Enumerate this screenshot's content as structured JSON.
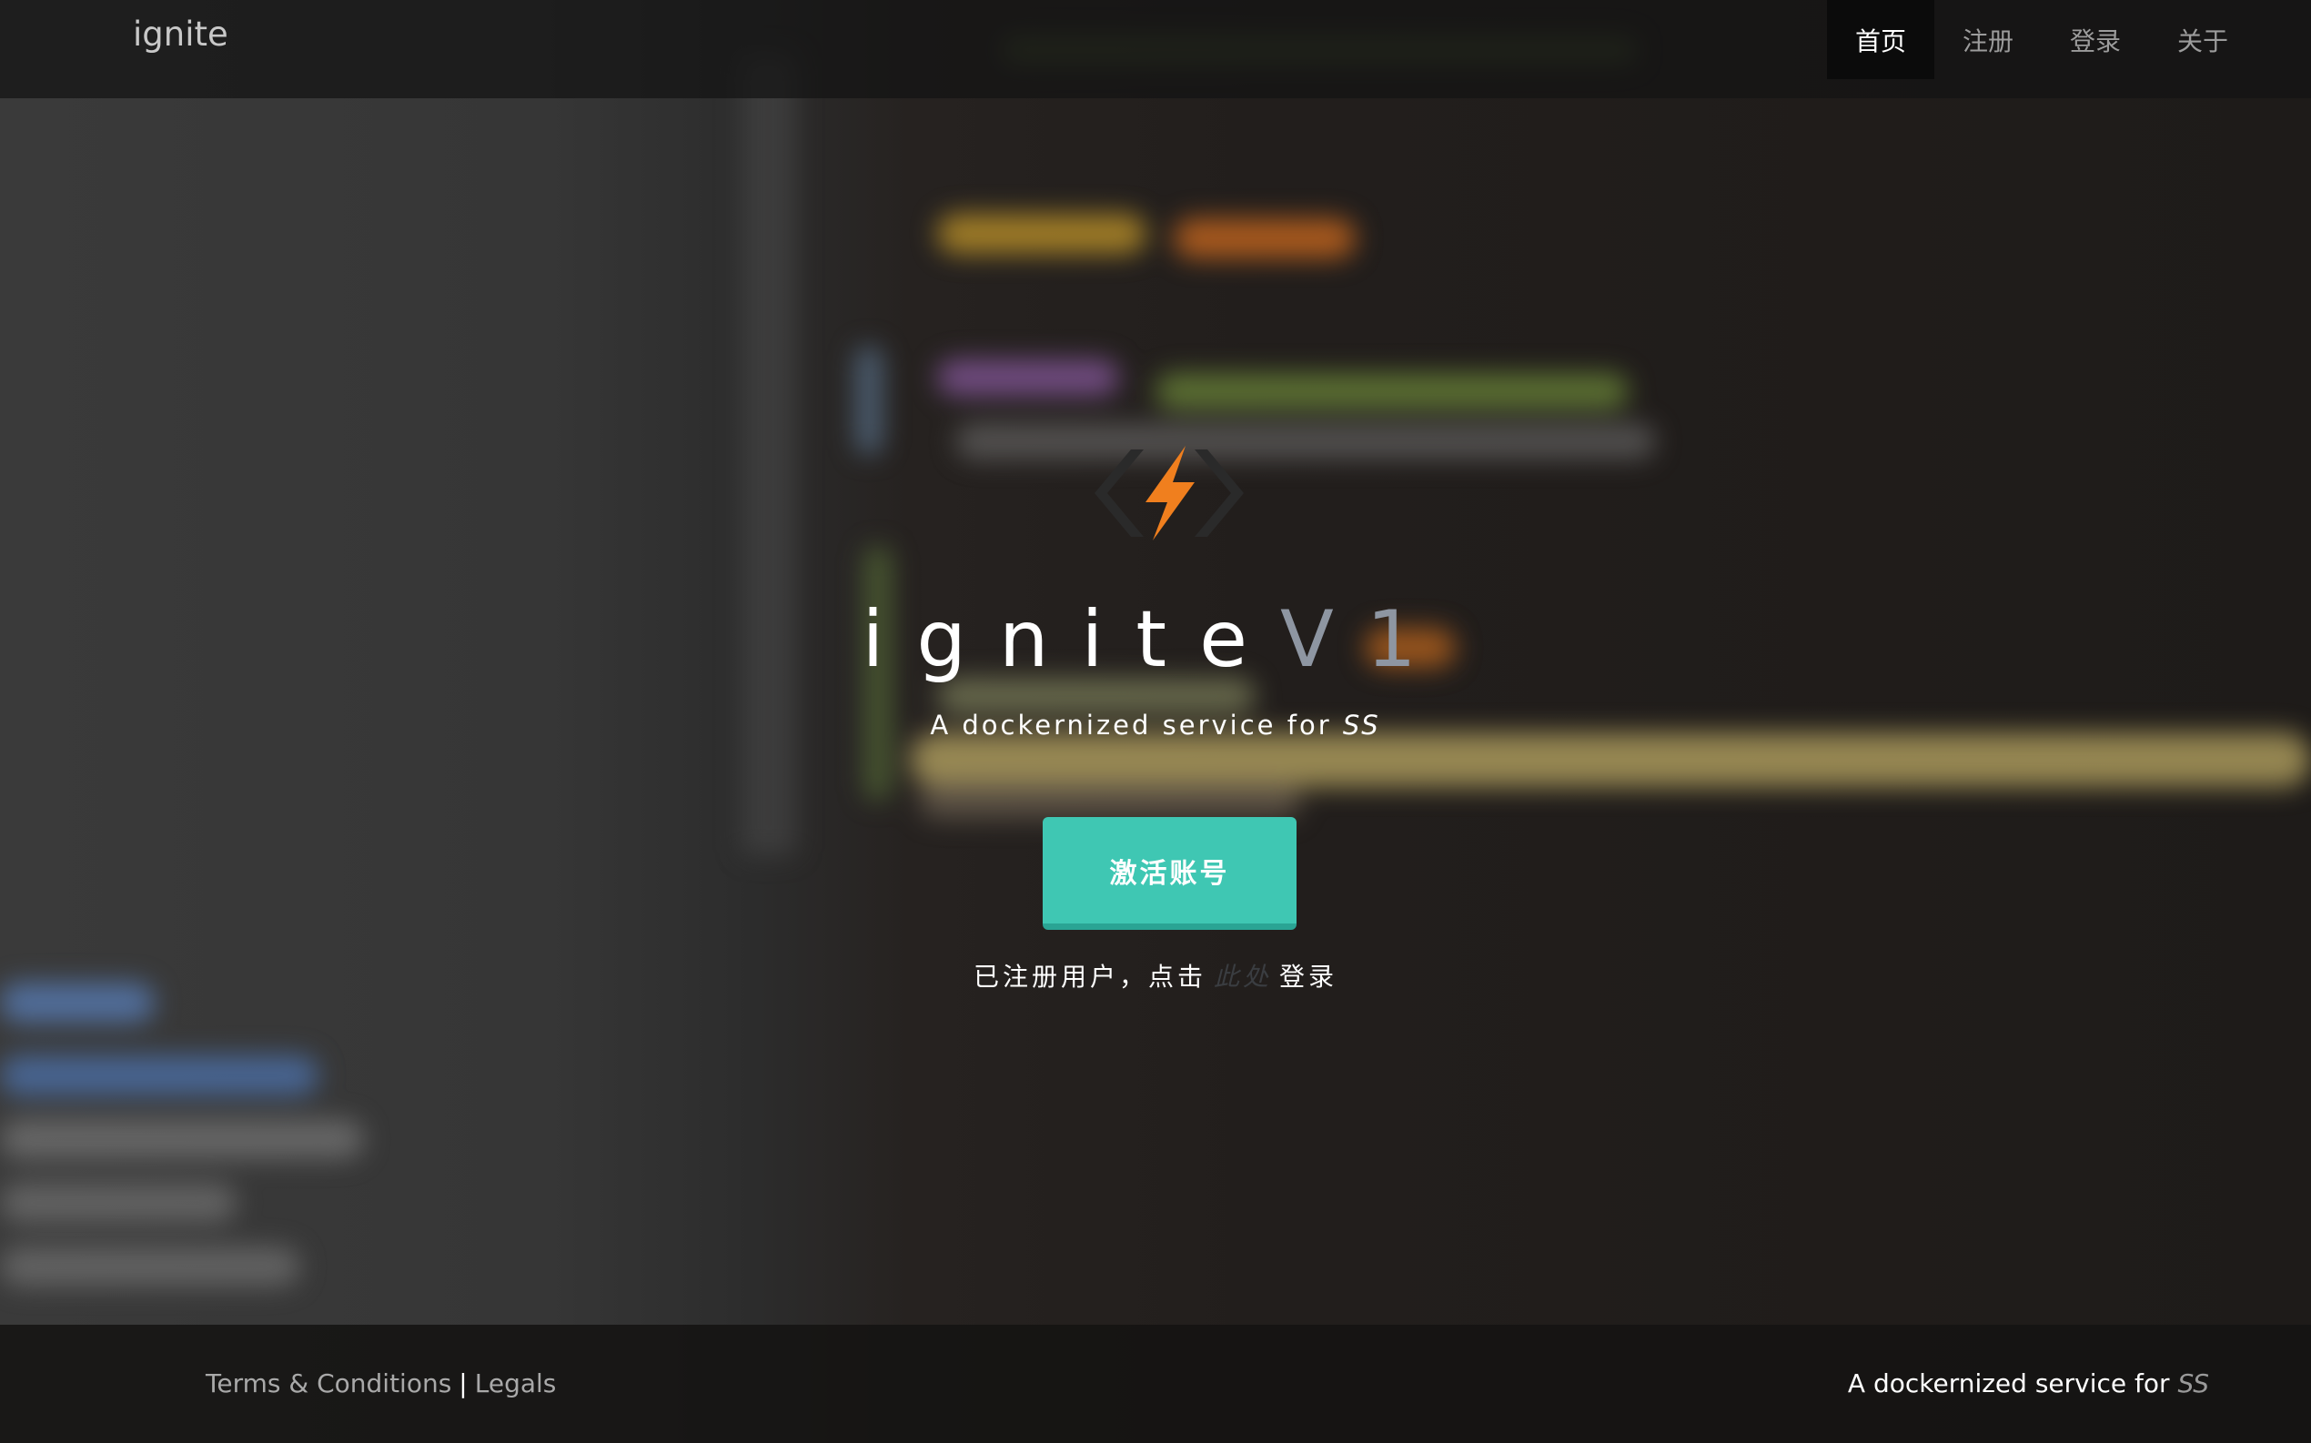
{
  "navbar": {
    "brand": "ignite",
    "items": [
      {
        "label": "首页",
        "active": true
      },
      {
        "label": "注册",
        "active": false
      },
      {
        "label": "登录",
        "active": false
      },
      {
        "label": "关于",
        "active": false
      }
    ]
  },
  "hero": {
    "logo_icon": "bolt-code-brackets-icon",
    "title": "ignite",
    "version": "V1",
    "subtitle_prefix": "A dockernized service for ",
    "subtitle_em": "SS",
    "cta_label": "激活账号",
    "login_prefix": "已注册用户，点击",
    "login_link": "此处",
    "login_suffix": "登录"
  },
  "footer": {
    "terms": "Terms & Conditions",
    "separator": "|",
    "legals": "Legals",
    "tagline_prefix": "A dockernized service for ",
    "tagline_em": "SS"
  },
  "colors": {
    "accent": "#3fc7b3",
    "logo_orange": "#f07f1e",
    "version_gray": "#8e96a2"
  }
}
